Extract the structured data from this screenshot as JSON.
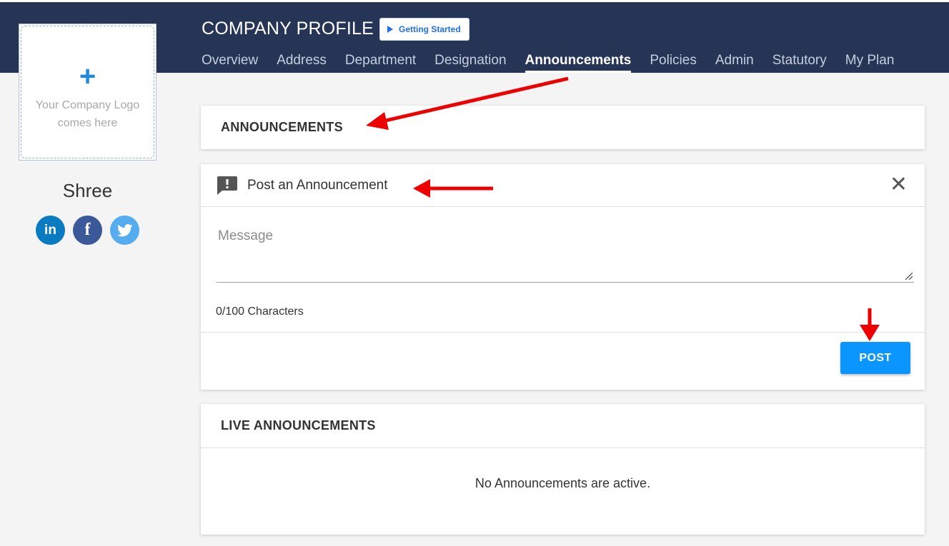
{
  "header": {
    "title": "COMPANY PROFILE",
    "getting_started_label": "Getting Started",
    "tabs": [
      {
        "label": "Overview"
      },
      {
        "label": "Address"
      },
      {
        "label": "Department"
      },
      {
        "label": "Designation"
      },
      {
        "label": "Announcements",
        "active": true
      },
      {
        "label": "Policies"
      },
      {
        "label": "Admin"
      },
      {
        "label": "Statutory"
      },
      {
        "label": "My Plan"
      }
    ]
  },
  "sidebar": {
    "logo_placeholder": "Your Company Logo comes here",
    "company_name": "Shree",
    "socials": [
      {
        "icon": "linkedin-icon",
        "glyph": "in"
      },
      {
        "icon": "facebook-icon",
        "glyph": "f"
      },
      {
        "icon": "twitter-icon"
      }
    ]
  },
  "announcements_card": {
    "title": "ANNOUNCEMENTS"
  },
  "post_card": {
    "title": "Post an Announcement",
    "close_glyph": "✕",
    "message_placeholder": "Message",
    "message_value": "",
    "char_count": "0/100 Characters",
    "post_label": "POST"
  },
  "live_card": {
    "title": "LIVE ANNOUNCEMENTS",
    "empty_message": "No Announcements are active."
  },
  "colors": {
    "header_bg": "#263455",
    "primary_button": "#0b95ff",
    "annotation_arrow": "#ee0000"
  }
}
